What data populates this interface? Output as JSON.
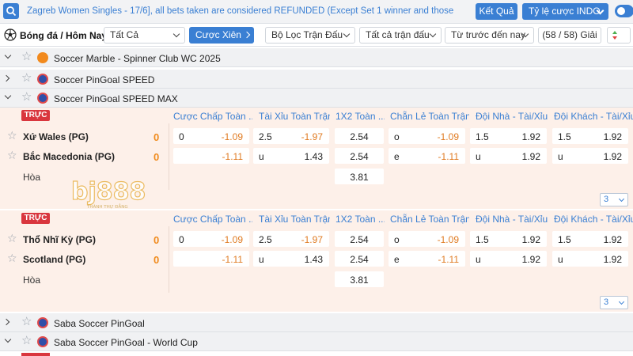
{
  "topbar": {
    "notice": "Zagreb Women Singles - 17/6], all bets taken are considered REFUNDED (Except Set 1 winner and those",
    "result_label": "Kết Quả",
    "odds_type_label": "Tỷ lệ cược INDO"
  },
  "filterbar": {
    "sport_title": "Bóng đá / Hôm Nay",
    "scope_select": "Tất Cả",
    "parlay_label": "Cược Xiên",
    "filter_select": "Bộ Lọc Trận Đấu",
    "all_matches_select": "Tất cả trận đấu",
    "from_before_select": "Từ trước đến nay",
    "league_count": "(58 / 58) Giải"
  },
  "leagues": [
    {
      "name": "Soccer Marble - Spinner Club WC 2025"
    },
    {
      "name": "Soccer PinGoal SPEED"
    },
    {
      "name": "Soccer PinGoal SPEED MAX"
    },
    {
      "name": "Saba Soccer PinGoal"
    },
    {
      "name": "Saba Soccer PinGoal - World Cup"
    }
  ],
  "columns": [
    "Cược Chấp Toàn ...",
    "Tài Xỉu Toàn Trận",
    "1X2 Toàn ...",
    "Chẵn Lẻ Toàn Trận",
    "Đội Nhà - Tài/Xỉu",
    "Đội Khách - Tài/Xỉu"
  ],
  "matches": [
    {
      "live_label": "TRỰC",
      "home": {
        "name": "Xứ Wales (PG)",
        "score": "0"
      },
      "away": {
        "name": "Bắc Macedonia (PG)",
        "score": "0"
      },
      "draw_label": "Hòa",
      "handicap": {
        "home_line": "0",
        "home_odds": "-1.09",
        "away_odds": "-1.11"
      },
      "over_under": {
        "line": "2.5",
        "over_odds": "-1.97",
        "under_label": "u",
        "under_odds": "1.43"
      },
      "x12": {
        "home": "2.54",
        "away": "2.54",
        "draw": "3.81"
      },
      "odd_even": {
        "odd_label": "o",
        "odd_odds": "-1.09",
        "even_label": "e",
        "even_odds": "-1.11"
      },
      "home_ou": {
        "line": "1.5",
        "over": "1.92",
        "under_label": "u",
        "under": "1.92"
      },
      "away_ou": {
        "line": "1.5",
        "over": "1.92",
        "under_label": "u",
        "under": "1.92"
      },
      "more": "3"
    },
    {
      "live_label": "TRỰC",
      "home": {
        "name": "Thổ Nhĩ Kỳ (PG)",
        "score": "0"
      },
      "away": {
        "name": "Scotland (PG)",
        "score": "0"
      },
      "draw_label": "Hòa",
      "handicap": {
        "home_line": "0",
        "home_odds": "-1.09",
        "away_odds": "-1.11"
      },
      "over_under": {
        "line": "2.5",
        "over_odds": "-1.97",
        "under_label": "u",
        "under_odds": "1.43"
      },
      "x12": {
        "home": "2.54",
        "away": "2.54",
        "draw": "3.81"
      },
      "odd_even": {
        "odd_label": "o",
        "odd_odds": "-1.09",
        "even_label": "e",
        "even_odds": "-1.11"
      },
      "home_ou": {
        "line": "1.5",
        "over": "1.92",
        "under_label": "u",
        "under": "1.92"
      },
      "away_ou": {
        "line": "1.5",
        "over": "1.92",
        "under_label": "u",
        "under": "1.92"
      },
      "more": "3"
    }
  ],
  "watermark": {
    "brand": "bj888",
    "tagline": "THÀNH THỰ ĐẲNG"
  },
  "icons": {
    "search": "search-icon",
    "ball": "soccer-ball-icon",
    "star": "star-icon",
    "league_logo": "league-logo-icon",
    "chevron": "chevron-down-icon"
  },
  "colors": {
    "accent": "#3a7fd3",
    "live": "#d9363e",
    "score": "#f08a1c",
    "negative": "#e07b22",
    "match_bg": "#fdf0e9"
  }
}
